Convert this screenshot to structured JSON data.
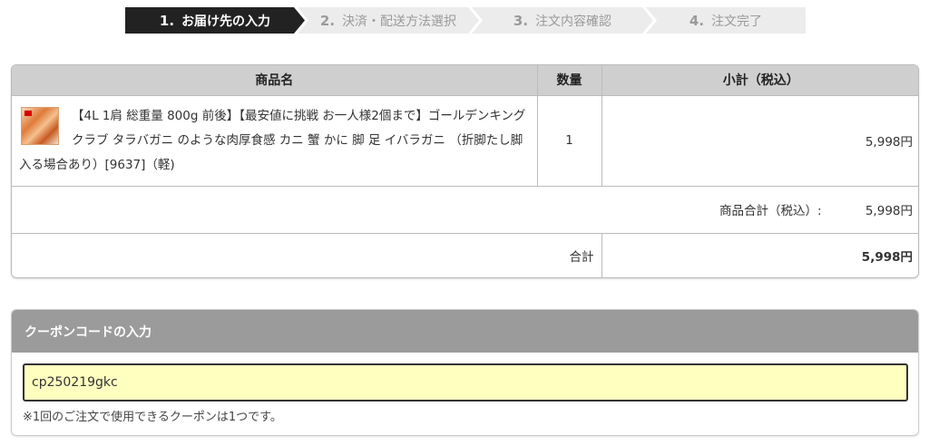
{
  "steps": [
    {
      "num": "1.",
      "label": "お届け先の入力"
    },
    {
      "num": "2.",
      "label": "決済・配送方法選択"
    },
    {
      "num": "3.",
      "label": "注文内容確認"
    },
    {
      "num": "4.",
      "label": "注文完了"
    }
  ],
  "cart": {
    "headers": {
      "product": "商品名",
      "quantity": "数量",
      "subtotal": "小計（税込）"
    },
    "item": {
      "name": "【4L 1肩 総重量 800g 前後】【最安値に挑戦 お一人様2個まで】ゴールデンキングクラブ タラバガニ のような肉厚食感 カニ 蟹 かに 脚 足 イバラガニ （折脚たし脚入る場合あり）[9637]（軽)",
      "quantity": "1",
      "price": "5,998円"
    },
    "product_total_label": "商品合計（税込）:",
    "product_total_value": "5,998円",
    "total_label": "合計",
    "total_value": "5,998円"
  },
  "coupon": {
    "title": "クーポンコードの入力",
    "value": "cp250219gkc",
    "note": "※1回のご注文で使用できるクーポンは1つです。"
  },
  "colors": {
    "total_price": "#e60012",
    "coupon_input_bg": "#ffffc0",
    "active_step_bg": "#222222"
  }
}
